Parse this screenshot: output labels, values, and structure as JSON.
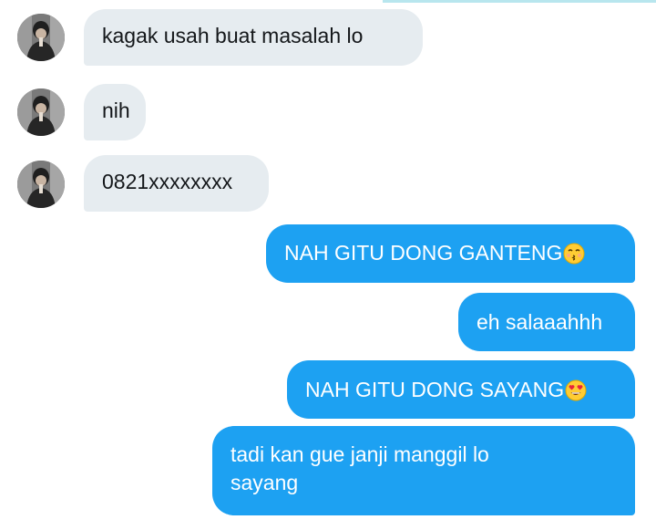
{
  "conversation": {
    "messages": [
      {
        "sender": "other",
        "text": "kagak usah buat masalah lo"
      },
      {
        "sender": "other",
        "text": "nih"
      },
      {
        "sender": "other",
        "text": "0821xxxxxxxx"
      },
      {
        "sender": "me",
        "text": "NAH GITU DONG GANTENG",
        "emoji": "kissing-face-icon"
      },
      {
        "sender": "me",
        "text": "eh salaaahhh"
      },
      {
        "sender": "me",
        "text": "NAH GITU DONG SAYANG",
        "emoji": "heart-eyes-face-icon"
      },
      {
        "sender": "me",
        "lines": [
          "tadi kan gue janji manggil lo",
          "sayang"
        ]
      }
    ]
  },
  "colors": {
    "incoming_bubble": "#e6ecf0",
    "outgoing_bubble": "#1da1f2",
    "incoming_text": "#14171a",
    "outgoing_text": "#ffffff"
  }
}
